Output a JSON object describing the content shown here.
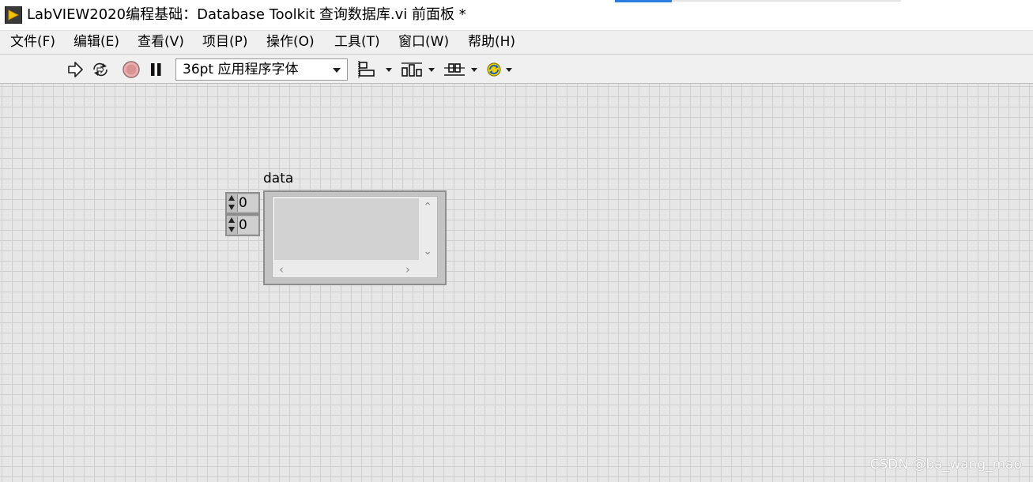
{
  "window": {
    "title": "LabVIEW2020编程基础：Database Toolkit 查询数据库.vi 前面板 *",
    "icon": "labview-vi-icon"
  },
  "menu": {
    "items": [
      {
        "label": "文件(F)"
      },
      {
        "label": "编辑(E)"
      },
      {
        "label": "查看(V)"
      },
      {
        "label": "项目(P)"
      },
      {
        "label": "操作(O)"
      },
      {
        "label": "工具(T)"
      },
      {
        "label": "窗口(W)"
      },
      {
        "label": "帮助(H)"
      }
    ]
  },
  "toolbar": {
    "buttons": [
      "run-arrow-icon",
      "run-continuously-icon",
      "abort-execution-icon",
      "pause-icon"
    ],
    "font_select": {
      "value": "36pt 应用程序字体"
    },
    "dropdowns": [
      "align-objects-icon",
      "distribute-objects-icon",
      "resize-objects-icon",
      "reorder-icon"
    ]
  },
  "front_panel": {
    "array_control": {
      "label": "data",
      "index_row": "0",
      "index_col": "0",
      "element": {
        "value": ""
      }
    }
  },
  "watermark": "CSDN @ba_wang_mao"
}
